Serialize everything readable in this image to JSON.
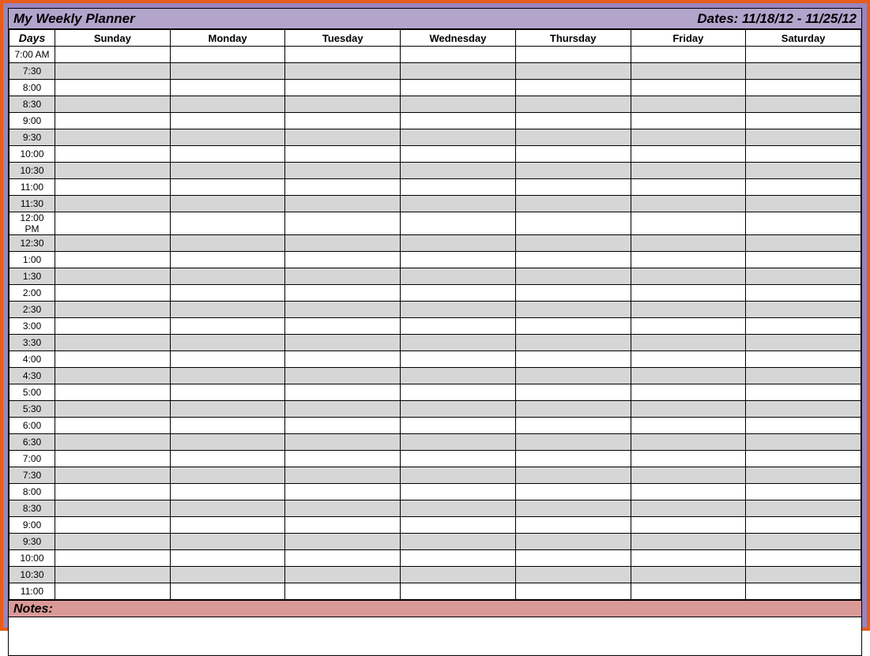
{
  "header": {
    "title": "My Weekly Planner",
    "dates_label": "Dates: 11/18/12 - 11/25/12"
  },
  "columns": {
    "days_label": "Days",
    "day_names": [
      "Sunday",
      "Monday",
      "Tuesday",
      "Wednesday",
      "Thursday",
      "Friday",
      "Saturday"
    ]
  },
  "time_slots": [
    "7:00 AM",
    "7:30",
    "8:00",
    "8:30",
    "9:00",
    "9:30",
    "10:00",
    "10:30",
    "11:00",
    "11:30",
    "12:00 PM",
    "12:30",
    "1:00",
    "1:30",
    "2:00",
    "2:30",
    "3:00",
    "3:30",
    "4:00",
    "4:30",
    "5:00",
    "5:30",
    "6:00",
    "6:30",
    "7:00",
    "7:30",
    "8:00",
    "8:30",
    "9:00",
    "9:30",
    "10:00",
    "10:30",
    "11:00"
  ],
  "notes": {
    "label": "Notes:",
    "content": ""
  }
}
